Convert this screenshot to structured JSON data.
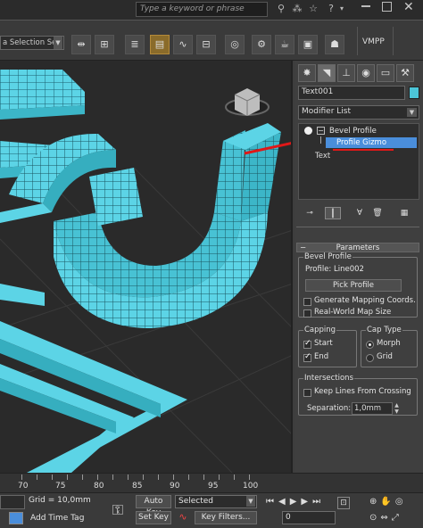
{
  "search": {
    "placeholder": "Type a keyword or phrase"
  },
  "top_icons": [
    "binoculars-icon",
    "network-icon",
    "star-icon",
    "help-icon"
  ],
  "toolbar": {
    "selection_set": "a Selection Set",
    "vmpp": "VMPP"
  },
  "panel": {
    "object_name": "Text001",
    "object_color": "#4cc5d8",
    "modifier_list": "Modifier List",
    "stack": {
      "modifier": "Bevel Profile",
      "sub_item": "Profile Gizmo",
      "base": "Text"
    },
    "parameters": {
      "title": "Parameters",
      "bevel_profile_group": "Bevel Profile",
      "profile_label": "Profile: Line002",
      "pick_profile": "Pick Profile",
      "generate_mapping": "Generate Mapping Coords.",
      "real_world_map": "Real-World Map Size",
      "capping_group": "Capping",
      "start": "Start",
      "end": "End",
      "cap_type_group": "Cap Type",
      "morph": "Morph",
      "grid": "Grid",
      "intersections_group": "Intersections",
      "keep_lines": "Keep Lines From Crossing",
      "separation_label": "Separation:",
      "separation_value": "1,0mm"
    }
  },
  "timeline": {
    "ticks": [
      "70",
      "75",
      "80",
      "85",
      "90",
      "95",
      "100"
    ]
  },
  "status": {
    "grid": "Grid = 10,0mm",
    "add_time_tag": "Add Time Tag",
    "auto_key": "Auto Key",
    "set_key": "Set Key",
    "key_mode": "Selected",
    "key_filters": "Key Filters...",
    "frame": "0"
  }
}
